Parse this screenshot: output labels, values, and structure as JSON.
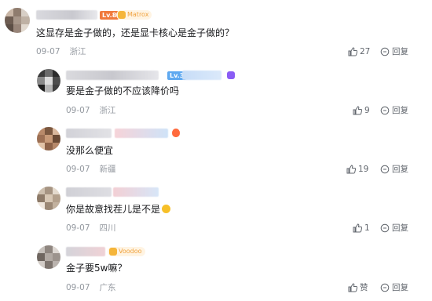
{
  "comments": [
    {
      "level": "Lv.8",
      "medal": "Matrox",
      "text": "这显存是金子做的，还是显卡核心是金子做的？",
      "date": "09-07",
      "location": "浙江",
      "likes": "27",
      "reply_label": "回复"
    },
    {
      "level": "Lv.3",
      "text": "要是金子做的不应该降价吗",
      "date": "09-07",
      "location": "浙江",
      "likes": "9",
      "reply_label": "回复"
    },
    {
      "text": "没那么便宜",
      "date": "09-07",
      "location": "新疆",
      "likes": "19",
      "reply_label": "回复"
    },
    {
      "text": "你是故意找茬儿是不是",
      "date": "09-07",
      "location": "四川",
      "likes": "1",
      "reply_label": "回复"
    },
    {
      "medal": "Voodoo",
      "text": "金子要5w嘛？",
      "date": "09-07",
      "location": "广东",
      "likes": "赞",
      "reply_label": "回复"
    }
  ],
  "colors": {
    "level_badge": "#f07a3c",
    "medal_text": "#f0a13c",
    "meta_text": "#9499a0"
  },
  "icons": {
    "like": "thumbs-up-icon",
    "reply": "reply-bubble-icon"
  }
}
